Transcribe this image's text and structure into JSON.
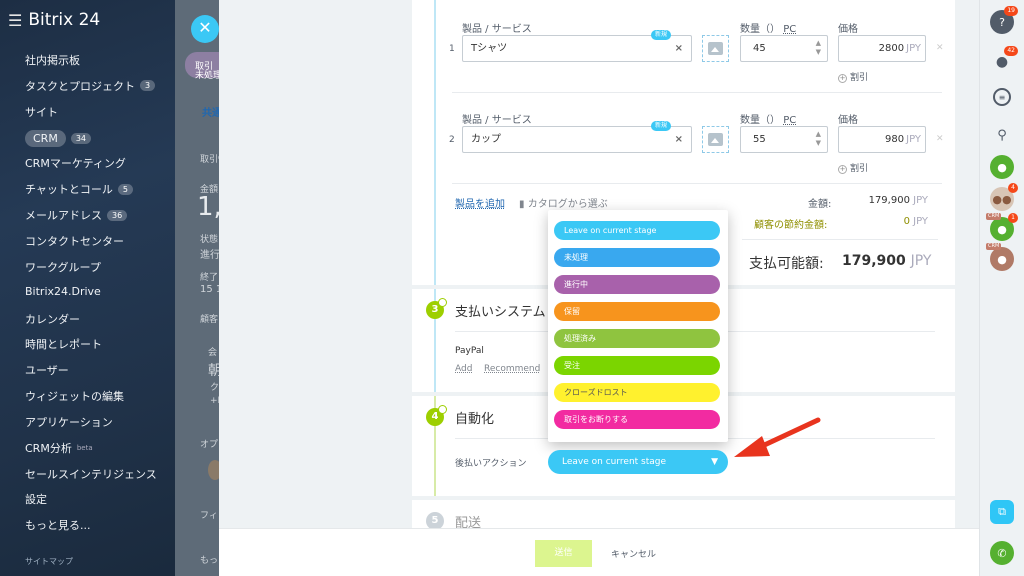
{
  "sidebar": {
    "brand": "Bitrix 24",
    "items": [
      {
        "label": "社内掲示板",
        "badge": null
      },
      {
        "label": "タスクとプロジェクト",
        "badge": "3"
      },
      {
        "label": "サイト",
        "badge": null
      },
      {
        "label": "CRM",
        "badge": "34"
      },
      {
        "label": "CRMマーケティング",
        "badge": null
      },
      {
        "label": "チャットとコール",
        "badge": "5"
      },
      {
        "label": "メールアドレス",
        "badge": "36"
      },
      {
        "label": "コンタクトセンター",
        "badge": null
      },
      {
        "label": "ワークグループ",
        "badge": null
      },
      {
        "label": "Bitrix24.Drive",
        "badge": null
      },
      {
        "label": "カレンダー",
        "badge": null
      },
      {
        "label": "時間とレポート",
        "badge": null
      },
      {
        "label": "ユーザー",
        "badge": null
      },
      {
        "label": "ウィジェットの編集",
        "badge": null
      },
      {
        "label": "アプリケーション",
        "badge": null
      },
      {
        "label": "CRM分析",
        "badge": null,
        "sup": "beta"
      },
      {
        "label": "セールスインテリジェンス",
        "badge": null
      },
      {
        "label": "設定",
        "badge": null
      },
      {
        "label": "もっと見る...",
        "badge": null
      }
    ],
    "sitemap": "サイトマップ"
  },
  "background": {
    "tab_label": "取引",
    "status_label": "未処理",
    "shared_tab": "共通",
    "deal_info": "取引情",
    "amount_label": "金額",
    "amount_big": "1,",
    "state_label": "状態",
    "state_value": "進行",
    "end_label": "終了日",
    "end_value": "15 1",
    "customer": "顧客",
    "company": "会",
    "morning": "朝",
    "more_k": "ク",
    "plus_e": "+E",
    "option_label": "オプ",
    "filter_label": "フィ",
    "more_bottom": "もっと"
  },
  "products": {
    "rows": [
      {
        "num": "1",
        "name_label": "製品 / サービス",
        "name": "Tシャツ",
        "qty_label": "数量（）",
        "unit": "PC",
        "qty": "45",
        "price_label": "価格",
        "price": "2800",
        "currency": "JPY",
        "discount": "割引",
        "new_badge": "新規"
      },
      {
        "num": "2",
        "name_label": "製品 / サービス",
        "name": "カップ",
        "qty_label": "数量（）",
        "unit": "PC",
        "qty": "55",
        "price_label": "価格",
        "price": "980",
        "currency": "JPY",
        "discount": "割引",
        "new_badge": "新規"
      }
    ],
    "add_product": "製品を追加",
    "catalog": "カタログから選ぶ",
    "amount_label": "金額:",
    "amount_value": "179,900",
    "amount_currency": "JPY",
    "savings_label": "顧客の節約金額:",
    "savings_value": "0",
    "savings_currency": "JPY",
    "total_label": "支払可能額:",
    "total_value": "179,900",
    "total_currency": "JPY"
  },
  "payment": {
    "step": "3",
    "title": "支払いシステム",
    "system": "PayPal",
    "add": "Add",
    "recommend": "Recommend"
  },
  "automation": {
    "step": "4",
    "title": "自動化",
    "action_label": "後払いアクション",
    "selected": "Leave on current stage",
    "options": [
      {
        "label": "Leave on current stage",
        "color": "#3bc8f5"
      },
      {
        "label": "未処理",
        "color": "#39a8ef"
      },
      {
        "label": "進行中",
        "color": "#a861ab"
      },
      {
        "label": "保留",
        "color": "#f7941d"
      },
      {
        "label": "処理済み",
        "color": "#8fc43f"
      },
      {
        "label": "受注",
        "color": "#7bd500"
      },
      {
        "label": "クローズドロスト",
        "color": "#fff12e"
      },
      {
        "label": "取引をお断りする",
        "color": "#f22ba1"
      }
    ]
  },
  "delivery": {
    "step": "5",
    "title": "配送"
  },
  "footer": {
    "send": "送信",
    "cancel": "キャンセル"
  },
  "rightbar": {
    "help_badge": "19",
    "notif_badge": "42",
    "avatar_badge1": "4",
    "avatar_badge2": "1",
    "crm_tag": "CRM"
  }
}
